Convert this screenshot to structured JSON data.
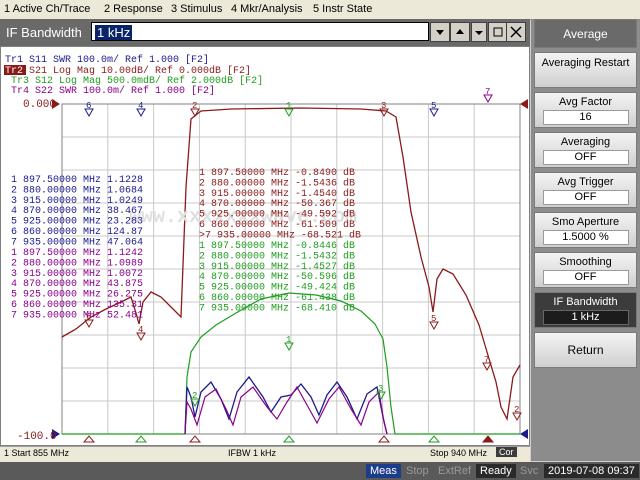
{
  "menu": [
    "1 Active Ch/Trace",
    "2 Response",
    "3 Stimulus",
    "4 Mkr/Analysis",
    "5 Instr State"
  ],
  "entry": {
    "label": "IF Bandwidth",
    "value": "1 kHz"
  },
  "traces": [
    {
      "id": "Tr1",
      "text": "S11  SWR 100.0m/ Ref 1.000  [F2]",
      "color": "#4b0082"
    },
    {
      "id": "Tr2",
      "text": "S21  Log Mag 10.00dB/ Ref 0.000dB  [F2]",
      "color": "#8b1a1a"
    },
    {
      "id": "Tr3",
      "text": "S12  Log Mag 500.0mdB/ Ref 2.000dB  [F2]",
      "color": "#228b22"
    },
    {
      "id": "Tr4",
      "text": "S22  SWR 100.0m/ Ref 1.000  [F2]",
      "color": "#8b008b"
    }
  ],
  "axis": {
    "top": "0.000",
    "bottom": "-100.0"
  },
  "watermark": "www.xxxxxxxwave.com",
  "table_left_1": [
    [
      "1",
      "897.50000 MHz",
      "1.1228"
    ],
    [
      "2",
      "880.00000 MHz",
      "1.0684"
    ],
    [
      "3",
      "915.00000 MHz",
      "1.0249"
    ],
    [
      "4",
      "870.00000 MHz",
      "38.467"
    ],
    [
      "5",
      "925.00000 MHz",
      "23.283"
    ],
    [
      "6",
      "860.00000 MHz",
      "124.87"
    ],
    [
      "7",
      "935.00000 MHz",
      "47.064"
    ]
  ],
  "table_left_2": [
    [
      "1",
      "897.50000 MHz",
      "1.1242"
    ],
    [
      "2",
      "880.00000 MHz",
      "1.0989"
    ],
    [
      "3",
      "915.00000 MHz",
      "1.0072"
    ],
    [
      "4",
      "870.00000 MHz",
      "43.875"
    ],
    [
      "5",
      "925.00000 MHz",
      "26.275"
    ],
    [
      "6",
      "860.00000 MHz",
      "135.31"
    ],
    [
      "7",
      "935.00000 MHz",
      "52.481"
    ]
  ],
  "table_right_1": [
    [
      " 1",
      "897.50000 MHz",
      "-0.8490 dB"
    ],
    [
      " 2",
      "880.00000 MHz",
      "-1.5436 dB"
    ],
    [
      " 3",
      "915.00000 MHz",
      "-1.4540 dB"
    ],
    [
      " 4",
      "870.00000 MHz",
      "-50.367 dB"
    ],
    [
      " 5",
      "925.00000 MHz",
      "-49.592 dB"
    ],
    [
      " 6",
      "860.00000 MHz",
      "-61.509 dB"
    ],
    [
      ">7",
      "935.00000 MHz",
      "-68.521 dB"
    ]
  ],
  "table_right_2": [
    [
      " 1",
      "897.50000 MHz",
      "-0.8446 dB"
    ],
    [
      " 2",
      "880.00000 MHz",
      "-1.5432 dB"
    ],
    [
      " 3",
      "915.00000 MHz",
      "-1.4527 dB"
    ],
    [
      " 4",
      "870.00000 MHz",
      "-50.596 dB"
    ],
    [
      " 5",
      "925.00000 MHz",
      "-49.424 dB"
    ],
    [
      " 6",
      "860.00000 MHz",
      "-61.438 dB"
    ],
    [
      " 7",
      "935.00000 MHz",
      "-68.410 dB"
    ]
  ],
  "softkeys": [
    {
      "label": "Average",
      "value": ""
    },
    {
      "label": "Averaging Restart",
      "value": ""
    },
    {
      "label": "Avg Factor",
      "value": "16"
    },
    {
      "label": "Averaging",
      "value": "OFF"
    },
    {
      "label": "Avg Trigger",
      "value": "OFF"
    },
    {
      "label": "Smo Aperture",
      "value": "1.5000  %"
    },
    {
      "label": "Smoothing",
      "value": "OFF"
    },
    {
      "label": "IF Bandwidth",
      "value": "1 kHz"
    },
    {
      "label": "Return",
      "value": ""
    }
  ],
  "status": {
    "start": "1  Start 855 MHz",
    "ifbw": "IFBW 1 kHz",
    "stop": "Stop 940 MHz",
    "cor": "Cor"
  },
  "bottom": {
    "meas": "Meas",
    "stop": "Stop",
    "extref": "ExtRef",
    "ready": "Ready",
    "svc": "Svc",
    "datetime": "2019-07-08 09:37"
  },
  "colors": {
    "s11": "#1a1a8c",
    "s21": "#8b1a1a",
    "s12": "#1f9d1f",
    "s22": "#8b008b"
  }
}
